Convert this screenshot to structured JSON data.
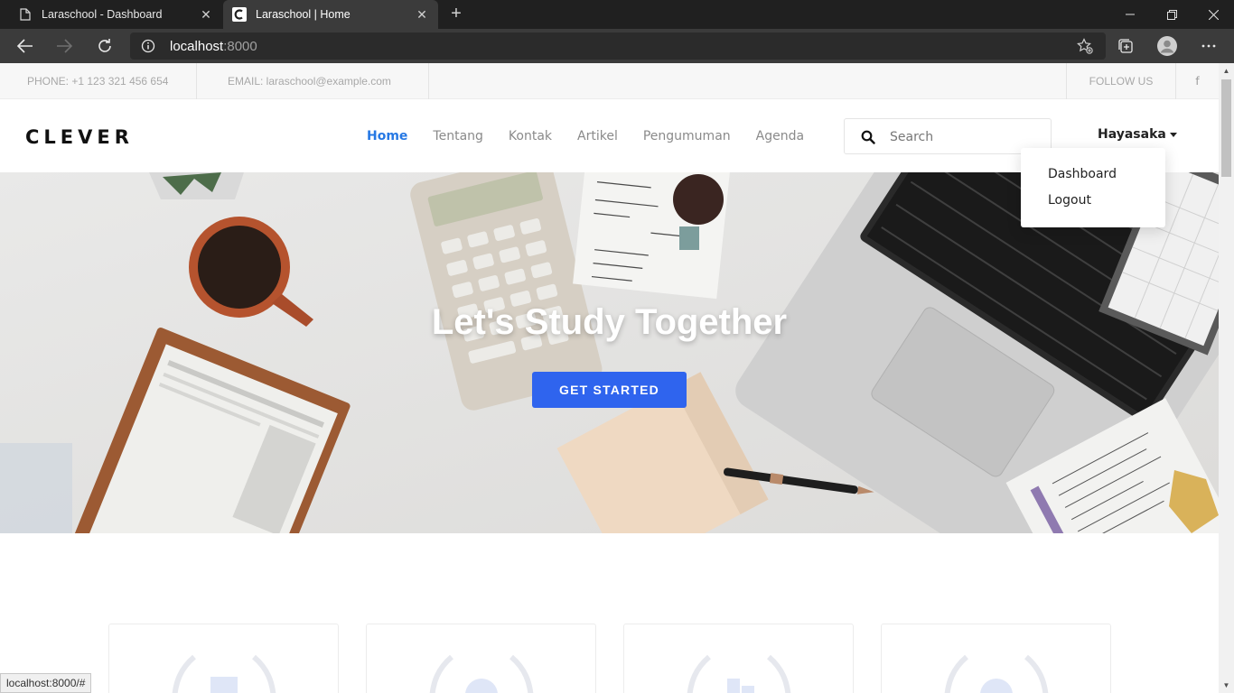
{
  "browser": {
    "tabs": [
      {
        "title": "Laraschool - Dashboard",
        "icon": "page-icon",
        "active": false
      },
      {
        "title": "Laraschool | Home",
        "icon": "site-favicon",
        "active": true
      }
    ],
    "address": {
      "host": "localhost",
      "port": ":8000"
    },
    "status_url": "localhost:8000/#"
  },
  "topbar": {
    "phone": "PHONE: +1 123 321 456 654",
    "email": "EMAIL: laraschool@example.com",
    "follow": "FOLLOW US",
    "facebook_glyph": "f"
  },
  "header": {
    "logo": "CLEVER",
    "menu": [
      "Home",
      "Tentang",
      "Kontak",
      "Artikel",
      "Pengumuman",
      "Agenda"
    ],
    "active_menu": "Home",
    "search_placeholder": "Search",
    "user_name": "Hayasaka",
    "dropdown": [
      "Dashboard",
      "Logout"
    ]
  },
  "hero": {
    "title": "Let's Study Together",
    "button": "GET STARTED"
  },
  "colors": {
    "accent": "#2f64ee",
    "menu_active": "#2678e4",
    "chrome_dark": "#202020",
    "chrome_mid": "#3b3b3b"
  }
}
